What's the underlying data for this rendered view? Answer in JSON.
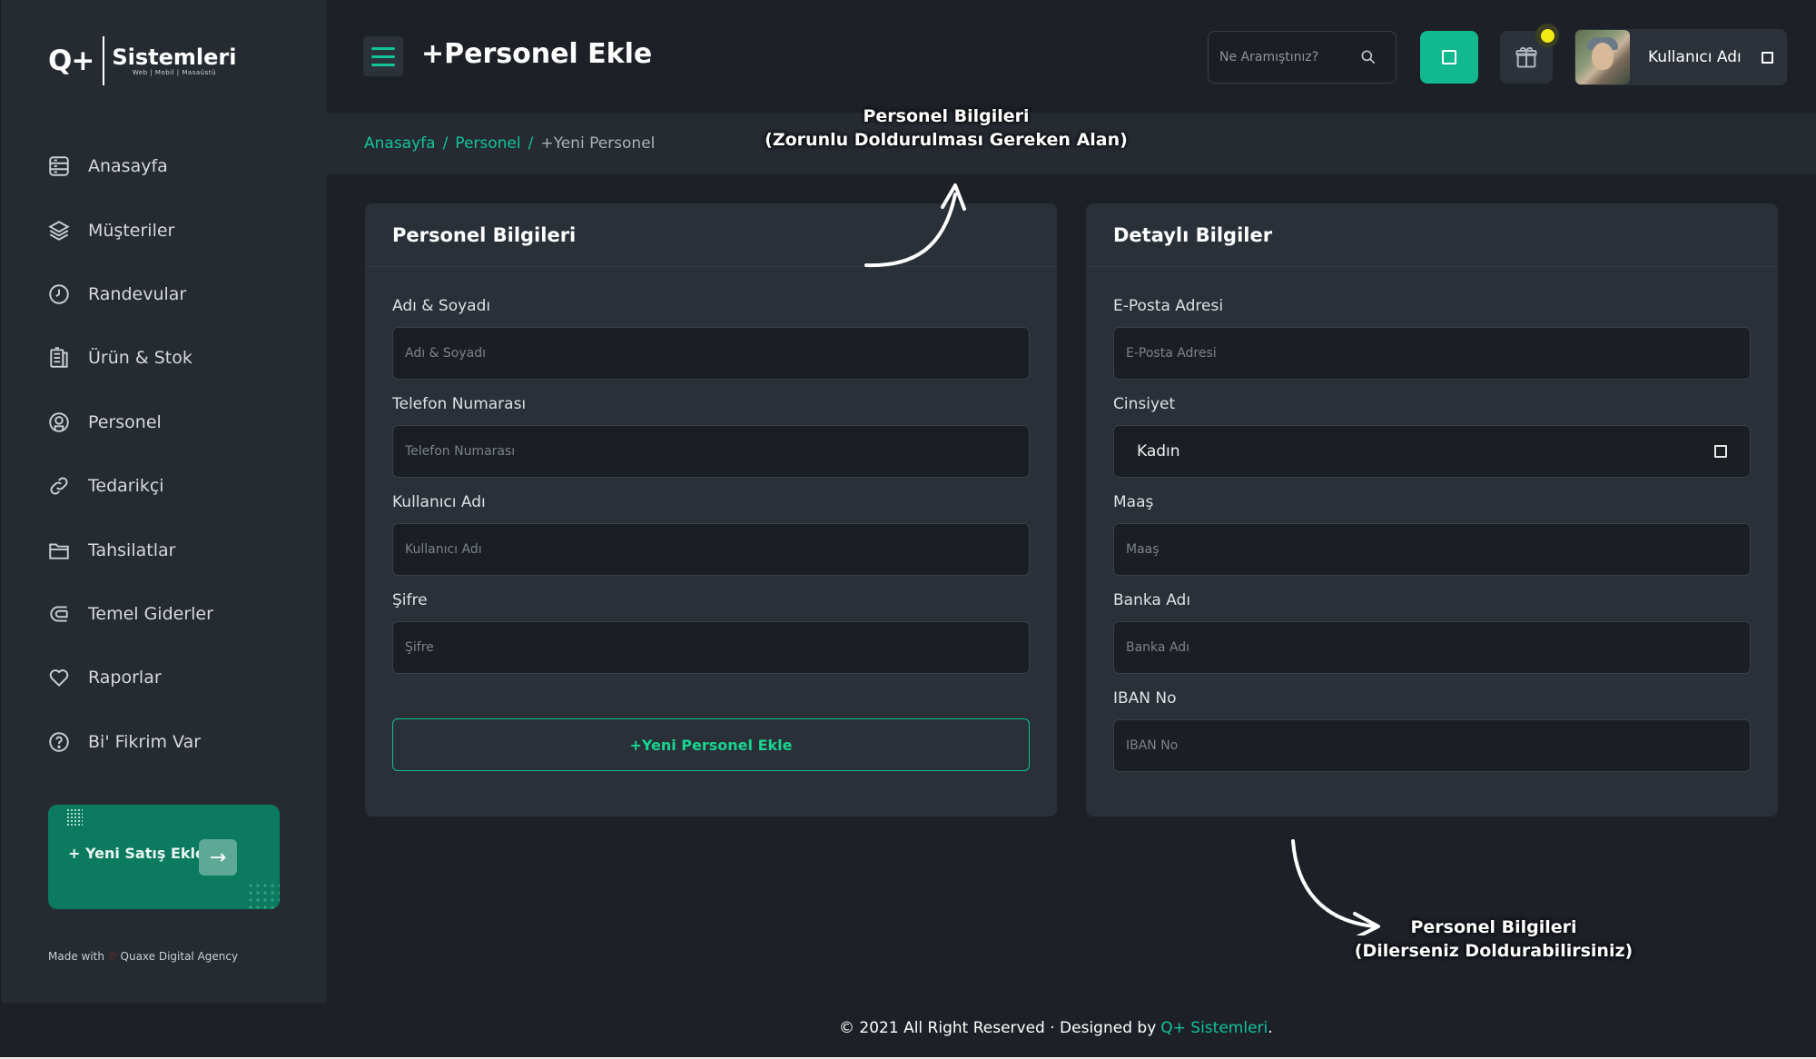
{
  "app": {
    "logo_mark": "Q+",
    "logo_name": "Sistemleri",
    "logo_sub": "Web | Mobil | Masaüstü"
  },
  "sidebar": {
    "items": [
      {
        "label": "Anasayfa",
        "icon": "dashboard-icon"
      },
      {
        "label": "Müşteriler",
        "icon": "layers-icon"
      },
      {
        "label": "Randevular",
        "icon": "clock-icon"
      },
      {
        "label": "Ürün & Stok",
        "icon": "inventory-icon"
      },
      {
        "label": "Personel",
        "icon": "user-circle-icon"
      },
      {
        "label": "Tedarikçi",
        "icon": "link-icon"
      },
      {
        "label": "Tahsilatlar",
        "icon": "folder-icon"
      },
      {
        "label": "Temel Giderler",
        "icon": "expenses-icon"
      },
      {
        "label": "Raporlar",
        "icon": "heart-icon"
      },
      {
        "label": "Bi' Fikrim Var",
        "icon": "question-icon"
      }
    ],
    "promo_label": "+ Yeni Satış Ekle",
    "made_with_prefix": "Made with",
    "made_with_agency": "Quaxe Digital Agency"
  },
  "header": {
    "title": "+Personel Ekle",
    "search_placeholder": "Ne Aramıştınız?",
    "user_name": "Kullanıcı Adı"
  },
  "breadcrumb": {
    "home": "Anasayfa",
    "section": "Personel",
    "current": "+Yeni Personel",
    "separator": "/"
  },
  "left_card": {
    "title": "Personel Bilgileri",
    "fields": [
      {
        "label": "Adı & Soyadı",
        "placeholder": "Adı & Soyadı",
        "value": ""
      },
      {
        "label": "Telefon Numarası",
        "placeholder": "Telefon Numarası",
        "value": ""
      },
      {
        "label": "Kullanıcı Adı",
        "placeholder": "Kullanıcı Adı",
        "value": ""
      },
      {
        "label": "Şifre",
        "placeholder": "Şifre",
        "value": ""
      }
    ],
    "submit_label": "+Yeni Personel Ekle"
  },
  "right_card": {
    "title": "Detaylı Bilgiler",
    "email": {
      "label": "E-Posta Adresi",
      "placeholder": "E-Posta Adresi",
      "value": ""
    },
    "gender": {
      "label": "Cinsiyet",
      "selected": "Kadın"
    },
    "salary": {
      "label": "Maaş",
      "placeholder": "Maaş",
      "value": ""
    },
    "bank": {
      "label": "Banka Adı",
      "placeholder": "Banka Adı",
      "value": ""
    },
    "iban": {
      "label": "IBAN No",
      "placeholder": "IBAN No",
      "value": ""
    }
  },
  "annotations": {
    "top_line1": "Personel Bilgileri",
    "top_line2": "(Zorunlu Doldurulması Gereken Alan)",
    "bottom_line1": "Personel Bilgileri",
    "bottom_line2": "(Dilerseniz Doldurabilirsiniz)"
  },
  "footer": {
    "text": "© 2021 All Right Reserved · Designed by",
    "brand": "Q+ Sistemleri",
    "suffix": "."
  },
  "colors": {
    "accent": "#12c39a",
    "background": "#1d2127",
    "panel": "#262b32",
    "card": "#2a3038",
    "promo": "#0b7a5e",
    "notification": "#f1ea14"
  }
}
